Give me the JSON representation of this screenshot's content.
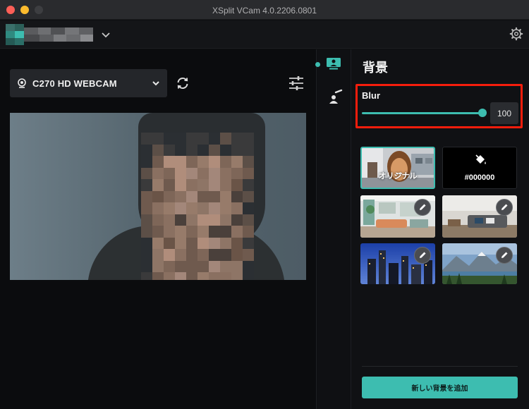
{
  "window": {
    "title": "XSplit VCam 4.0.2206.0801"
  },
  "camera": {
    "selected": "C270 HD WEBCAM"
  },
  "panel": {
    "title": "背景"
  },
  "blur": {
    "label": "Blur",
    "value": "100",
    "level_percent": 100
  },
  "backgrounds": [
    {
      "label": "オリジナル",
      "selected": true
    },
    {
      "label": "#000000",
      "selected": false
    },
    {
      "label": "",
      "selected": false
    },
    {
      "label": "",
      "selected": false
    },
    {
      "label": "",
      "selected": false
    },
    {
      "label": "",
      "selected": false
    }
  ],
  "add_background": {
    "label": "新しい背景を追加"
  },
  "colors": {
    "accent": "#3dbdb0",
    "highlight_box": "#f51d0c"
  },
  "icons": {
    "camera": "webcam-icon",
    "dropdown": "chevron-down-icon",
    "refresh": "refresh-icon",
    "settings": "gear-icon",
    "tune": "sliders-icon",
    "background_tab": "person-background-icon",
    "effects_tab": "person-effect-icon",
    "edit": "pencil-icon",
    "fill": "paint-bucket-icon"
  }
}
